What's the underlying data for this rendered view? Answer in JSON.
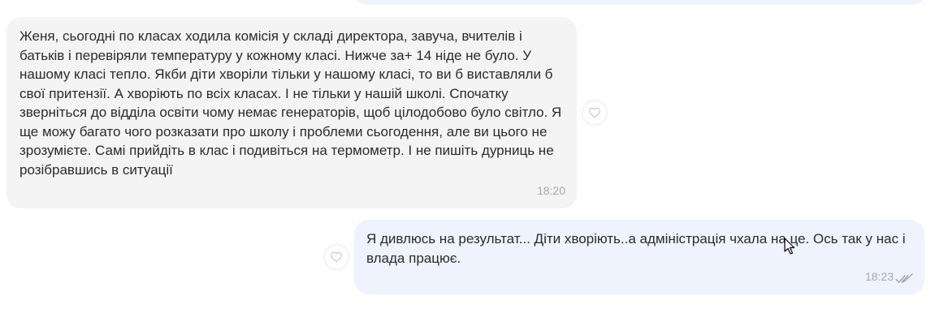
{
  "messages": [
    {
      "direction": "incoming",
      "text": "Женя, сьогодні по класах ходила комісія у складі директора, завуча, вчителів і батьків і перевіряли температуру у кожному класі. Нижче за+ 14 ніде не було. У нашому класі тепло. Якби діти хворіли тільки у нашому класі, то ви б виставляли б свої притензії. А хворіють по всіх класах. І не тільки у нашій школі. Спочатку зверніться до відділа освіти чому немає генераторів, щоб цілодобово було світло. Я ще можу багато чого розказати про школу і проблеми сьогодення, але ви цього не зрозумієте. Самі прийдіть в клас і подивіться на термометр. І не пишіть дурниць не розібравшись в ситуації",
      "time": "18:20"
    },
    {
      "direction": "outgoing",
      "text": "Я дивлюсь на результат... Діти хворіють..а адміністрація чхала на це. Ось так у нас і влада працює.",
      "time": "18:23",
      "status_icon": "double-check-icon"
    }
  ],
  "colors": {
    "incoming_bg": "#f4f4f4",
    "outgoing_bg": "#eef3fd",
    "text": "#2b2b2b",
    "time": "#a8a8a8"
  }
}
